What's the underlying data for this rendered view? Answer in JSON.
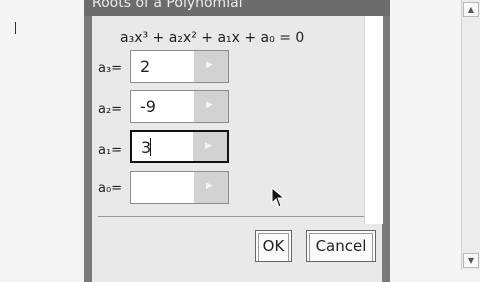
{
  "dialog": {
    "title": "Roots of a Polynomial",
    "equation": "a₃x³ + a₂x² + a₁x + a₀ = 0"
  },
  "coefficients": [
    {
      "label": "a₃=",
      "value": "2"
    },
    {
      "label": "a₂=",
      "value": "-9"
    },
    {
      "label": "a₁=",
      "value": "3"
    },
    {
      "label": "a₀=",
      "value": ""
    }
  ],
  "buttons": {
    "ok": "OK",
    "cancel": "Cancel"
  },
  "icons": {
    "spin": "right-arrow-icon",
    "scroll_up": "scroll-up-arrow-icon",
    "scroll_down": "scroll-down-arrow-icon",
    "pointer": "mouse-pointer-icon"
  },
  "colors": {
    "titlebar": "#6c6c6c",
    "dialog_body": "#e9e9e9",
    "spin_button": "#d2d2d2"
  }
}
